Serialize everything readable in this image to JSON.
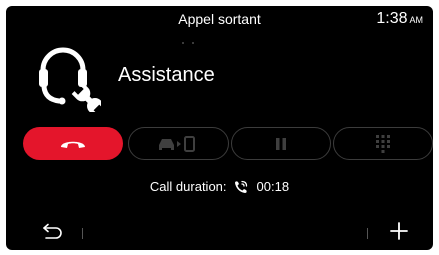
{
  "header": {
    "title": "Appel sortant",
    "clock_time": "1:38",
    "clock_ampm": "AM"
  },
  "call": {
    "contact_name": "Assistance",
    "contact_icon": "headset-wrench-icon",
    "duration_label": "Call duration:",
    "duration_icon": "phone-ringing-icon",
    "duration_value": "00:18"
  },
  "controls": {
    "hangup_icon": "hang-up-icon",
    "transfer_icon": "car-to-phone-icon",
    "pause_icon": "pause-icon",
    "keypad_icon": "keypad-icon"
  },
  "footer": {
    "back_icon": "back-arrow-icon",
    "add_icon": "plus-icon"
  },
  "colors": {
    "background": "#000000",
    "text": "#ffffff",
    "hangup": "#e4152b",
    "inactive_outline": "#3c3c3c",
    "inactive_icon": "#3f3f3f"
  }
}
